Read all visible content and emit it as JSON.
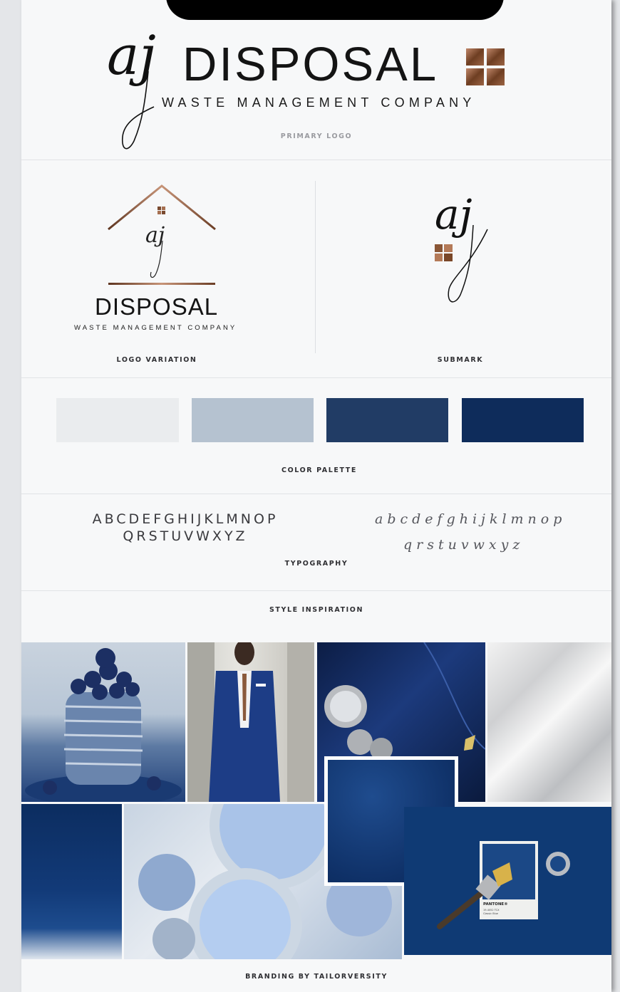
{
  "primary_logo": {
    "monogram": "aj",
    "wordmark": "DISPOSAL",
    "tagline": "WASTE MANAGEMENT COMPANY",
    "caption": "PRIMARY LOGO"
  },
  "logo_variation": {
    "monogram": "aj",
    "wordmark": "DISPOSAL",
    "tagline": "WASTE MANAGEMENT COMPANY",
    "caption": "LOGO VARIATION"
  },
  "submark": {
    "monogram": "aj",
    "caption": "SUBMARK"
  },
  "color_palette": {
    "caption": "COLOR PALETTE",
    "swatches": [
      "#eaecee",
      "#b5c2d0",
      "#213c65",
      "#0e2c5b"
    ]
  },
  "typography": {
    "uppercase_line1": "ABCDEFGHIJKLMNOP",
    "uppercase_line2": "QRSTUVWXYZ",
    "lowercase_line1": "abcdefghijklmnop",
    "lowercase_line2": "qrstuvwxyz",
    "caption": "TYPOGRAPHY"
  },
  "style_inspiration": {
    "caption": "STYLE INSPIRATION",
    "pantone_label": "PANTONE®",
    "pantone_code": "19-4052 TCX",
    "pantone_name": "Classic Blue"
  },
  "footer": {
    "credit": "BRANDING BY TAILORVERSITY"
  },
  "colors": {
    "accent_copper": "#8a5a3c",
    "navy": "#0e2c5b"
  },
  "icons": [
    "window-icon",
    "house-roof-icon",
    "paintbrush-icon"
  ]
}
